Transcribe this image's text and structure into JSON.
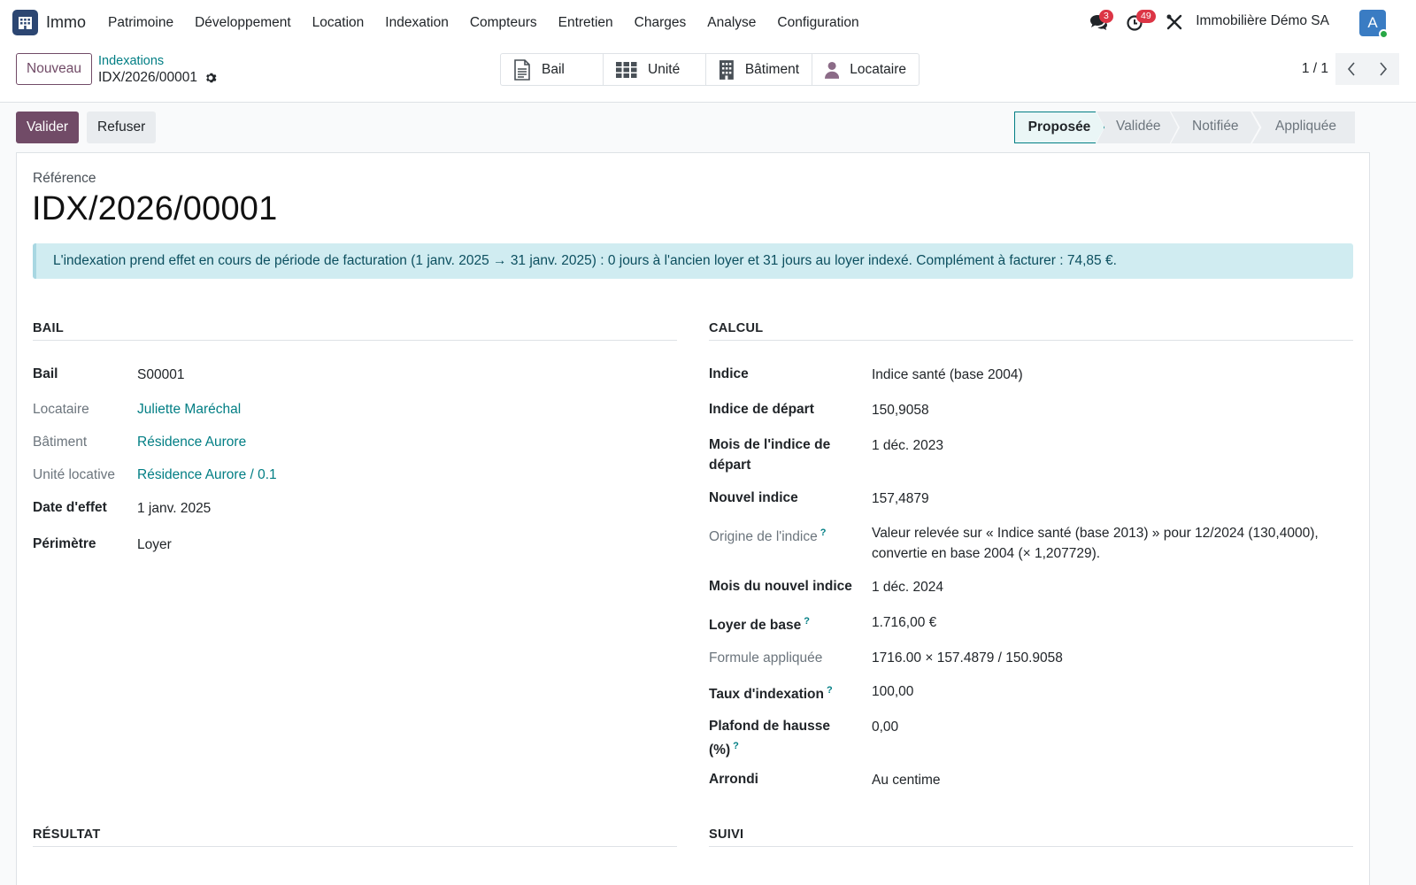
{
  "navbar": {
    "app_name": "Immo",
    "menu": [
      "Patrimoine",
      "Développement",
      "Location",
      "Indexation",
      "Compteurs",
      "Entretien",
      "Charges",
      "Analyse",
      "Configuration"
    ],
    "messages_count": "3",
    "activities_count": "49",
    "company": "Immobilière Démo SA",
    "avatar_letter": "A"
  },
  "control": {
    "new_label": "Nouveau",
    "breadcrumb_parent": "Indexations",
    "breadcrumb_current": "IDX/2026/00001",
    "smart_buttons": [
      {
        "label": "Bail",
        "icon": "document-icon"
      },
      {
        "label": "Unité",
        "icon": "grid-icon"
      },
      {
        "label": "Bâtiment",
        "icon": "building-icon"
      },
      {
        "label": "Locataire",
        "icon": "user-icon"
      }
    ],
    "pager": "1 / 1"
  },
  "actions": {
    "validate_label": "Valider",
    "refuse_label": "Refuser"
  },
  "statusbar": {
    "stages": [
      "Proposée",
      "Validée",
      "Notifiée",
      "Appliquée"
    ],
    "active_index": 0
  },
  "record": {
    "reference_label": "Référence",
    "reference": "IDX/2026/00001",
    "alert": "L'indexation prend effet en cours de période de facturation (1 janv. 2025 → 31 janv. 2025) : 0 jours à l'ancien loyer et 31 jours au loyer indexé. Complément à facturer : 74,85 €.",
    "bail_section": {
      "title": "BAIL",
      "bail_label": "Bail",
      "bail_value": "S00001",
      "tenant_label": "Locataire",
      "tenant_value": "Juliette Maréchal",
      "building_label": "Bâtiment",
      "building_value": "Résidence Aurore",
      "unit_label": "Unité locative",
      "unit_value": "Résidence Aurore / 0.1",
      "effect_date_label": "Date d'effet",
      "effect_date_value": "1 janv. 2025",
      "scope_label": "Périmètre",
      "scope_value": "Loyer"
    },
    "calcul_section": {
      "title": "CALCUL",
      "index_label": "Indice",
      "index_value": "Indice santé (base 2004)",
      "start_index_label": "Indice de départ",
      "start_index_value": "150,9058",
      "start_month_label_1": "Mois de l'indice de",
      "start_month_label_2": "départ",
      "start_month_value": "1 déc. 2023",
      "new_index_label": "Nouvel indice",
      "new_index_value": "157,4879",
      "origin_label": "Origine de l'indice",
      "origin_value_1": "Valeur relevée sur « Indice santé (base 2013) » pour 12/2024 (130,4000),",
      "origin_value_2": "convertie en base 2004 (× 1,207729).",
      "new_month_label": "Mois du nouvel indice",
      "new_month_value": "1 déc. 2024",
      "base_rent_label": "Loyer de base",
      "base_rent_value": "1.716,00 €",
      "formula_label": "Formule appliquée",
      "formula_value": "1716.00 × 157.4879 / 150.9058",
      "rate_label": "Taux d'indexation",
      "rate_value": "100,00",
      "cap_label_1": "Plafond de hausse",
      "cap_label_2": "(%)",
      "cap_value": "0,00",
      "rounding_label": "Arrondi",
      "rounding_value": "Au centime"
    },
    "result_section": {
      "title": "RÉSULTAT"
    },
    "follow_section": {
      "title": "SUIVI"
    },
    "help_mark": "?"
  }
}
